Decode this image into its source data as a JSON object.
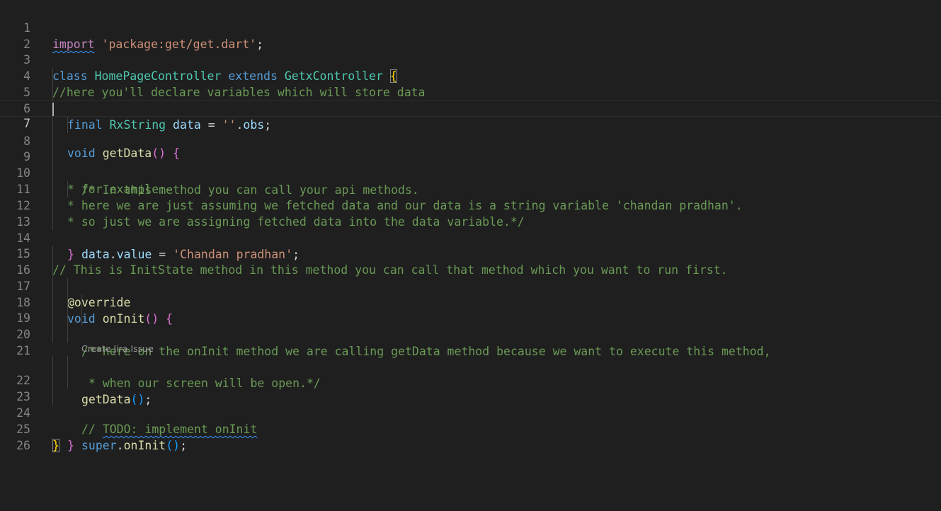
{
  "editor": {
    "language": "dart",
    "line_numbers": [
      "1",
      "2",
      "3",
      "4",
      "5",
      "6",
      "7",
      "8",
      "9",
      "10",
      "11",
      "12",
      "13",
      "14",
      "15",
      "16",
      "17",
      "18",
      "19",
      "20",
      "21",
      "22",
      "23",
      "24",
      "25",
      "26"
    ],
    "active_line": "7",
    "codelens": "Create Jira Issue",
    "tokens": {
      "l1_import": "import",
      "l1_str": "'package:get/get.dart'",
      "l1_semi": ";",
      "l3_class": "class",
      "l3_name": "HomePageController",
      "l3_extends": "extends",
      "l3_super": "GetxController",
      "l3_brace": "{",
      "l4_comment": "//here you'll declare variables which will store data",
      "l5_final": "final",
      "l5_type": "RxString",
      "l5_var": "data",
      "l5_eq": " = ",
      "l5_str": "''",
      "l5_dot": ".",
      "l5_obs": "obs",
      "l5_semi": ";",
      "l7_void": "void",
      "l7_fn": "getData",
      "l7_parens": "()",
      "l7_brace": "{",
      "l8_comment": "/* In this method you can call your api methods.",
      "l9_comment": "* for example:-",
      "l10_comment": "* here we are just assuming we fetched data and our data is a string variable 'chandan pradhan'.",
      "l11_comment": "* so just we are assigning fetched data into the data variable.*/",
      "l12_var": "data",
      "l12_dot": ".",
      "l12_prop": "value",
      "l12_eq": " = ",
      "l12_str": "'Chandan pradhan'",
      "l12_semi": ";",
      "l13_brace": "}",
      "l15_comment": "// This is InitState method in this method you can call that method which you want to run first.",
      "l16_annotation": "@override",
      "l17_void": "void",
      "l17_fn": "onInit",
      "l17_parens": "()",
      "l17_brace": "{",
      "l18_comment": "/**here on the onInit method we are calling getData method because we want to execute this method,",
      "l19_comment": "* when our screen will be open.*/",
      "l21_fn": "getData",
      "l21_parens": "()",
      "l21_semi": ";",
      "l22_prefix": "// ",
      "l22_todo": "TODO: implement onInit",
      "l23_super": "super",
      "l23_dot": ".",
      "l23_fn": "onInit",
      "l23_parens": "()",
      "l23_semi": ";",
      "l24_brace": "}",
      "l25_brace": "}"
    }
  },
  "colors": {
    "background": "#1f1f1f",
    "keyword": "#569cd6",
    "control_keyword": "#c586c0",
    "class_name": "#4ec9b0",
    "string": "#ce9178",
    "comment": "#6a9955",
    "variable": "#9cdcfe",
    "function": "#dcdcaa",
    "bracket_level1": "#ffd700",
    "bracket_level2": "#da70d6",
    "bracket_level3": "#179fff"
  }
}
